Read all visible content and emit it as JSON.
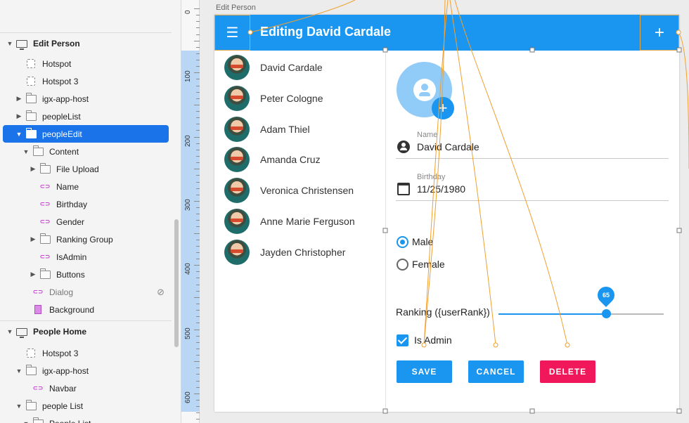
{
  "layers": {
    "rows": [
      {
        "label": "Edit Person",
        "kind": "artboard",
        "section": true
      },
      {
        "label": "Hotspot",
        "kind": "hotspot"
      },
      {
        "label": "Hotspot 3",
        "kind": "hotspot"
      },
      {
        "label": "igx-app-host",
        "kind": "folder",
        "expander": "▶"
      },
      {
        "label": "peopleList",
        "kind": "folder",
        "expander": "▶"
      },
      {
        "label": "peopleEdit",
        "kind": "folder",
        "expander": "▼",
        "selected": true
      },
      {
        "label": "Content",
        "kind": "folder",
        "expander": "▼"
      },
      {
        "label": "File Upload",
        "kind": "folder",
        "expander": "▶"
      },
      {
        "label": "Name",
        "kind": "link"
      },
      {
        "label": "Birthday",
        "kind": "link"
      },
      {
        "label": "Gender",
        "kind": "link"
      },
      {
        "label": "Ranking Group",
        "kind": "folder",
        "expander": "▶"
      },
      {
        "label": "IsAdmin",
        "kind": "link"
      },
      {
        "label": "Buttons",
        "kind": "folder",
        "expander": "▶"
      },
      {
        "label": "Dialog",
        "kind": "link",
        "hidden": true
      },
      {
        "label": "Background",
        "kind": "background"
      },
      {
        "label": "People Home",
        "kind": "artboard",
        "section": true
      },
      {
        "label": "Hotspot 3",
        "kind": "hotspot"
      },
      {
        "label": "igx-app-host",
        "kind": "folder",
        "expander": "▼"
      },
      {
        "label": "Navbar",
        "kind": "link"
      },
      {
        "label": "people List",
        "kind": "folder",
        "expander": "▼"
      },
      {
        "label": "People List",
        "kind": "folder",
        "expander": "▼"
      }
    ]
  },
  "ruler": {
    "labels": [
      "0",
      "100",
      "200",
      "300",
      "400",
      "500",
      "600"
    ]
  },
  "artboard_title": "Edit Person",
  "appbar": {
    "title": "Editing David Cardale",
    "menu_icon": "☰",
    "add_icon": "+"
  },
  "people": [
    "David Cardale",
    "Peter Cologne",
    "Adam Thiel",
    "Amanda Cruz",
    "Veronica Christensen",
    "Anne Marie Ferguson",
    "Jayden Christopher"
  ],
  "form": {
    "avatar_add_icon": "+",
    "name_label": "Name",
    "name_value": "David Cardale",
    "birthday_label": "Birthday",
    "birthday_value": "11/25/1980",
    "gender_options": [
      "Male",
      "Female"
    ],
    "gender_selected": "Male",
    "ranking_label": "Ranking ({userRank})",
    "ranking_value": 65,
    "ranking_max": 100,
    "is_admin_label": "Is Admin",
    "is_admin": true
  },
  "buttons": {
    "save": "SAVE",
    "cancel": "CANCEL",
    "delete": "DELETE"
  },
  "colors": {
    "primary": "#1a96f0",
    "danger": "#f0185a",
    "selection": "#1a73e8",
    "link_line": "#f0a030"
  }
}
